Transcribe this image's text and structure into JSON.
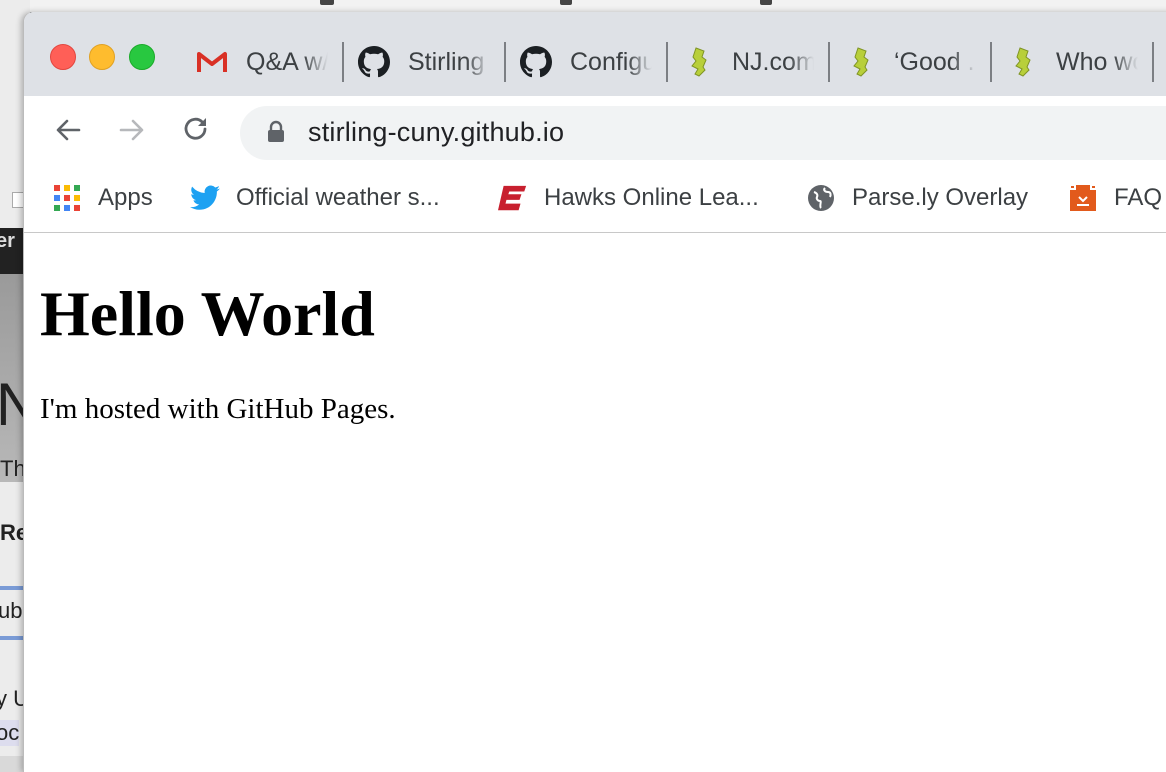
{
  "background_window": {
    "fragments": [
      "er",
      "N",
      "Th",
      "Re",
      "ub",
      "y U",
      "oc"
    ]
  },
  "tabs": [
    {
      "title": "Q&A w/",
      "icon": "gmail-icon"
    },
    {
      "title": "Stirling",
      "icon": "github-icon"
    },
    {
      "title": "Configu",
      "icon": "github-icon"
    },
    {
      "title": "NJ.com",
      "icon": "nj-icon"
    },
    {
      "title": "‘Good ...",
      "icon": "nj-icon"
    },
    {
      "title": "Who wo",
      "icon": "nj-icon"
    }
  ],
  "toolbar": {
    "back_icon": "back-arrow-icon",
    "forward_icon": "forward-arrow-icon",
    "reload_icon": "reload-icon",
    "url": "stirling-cuny.github.io"
  },
  "bookmarks": [
    {
      "label": "Apps",
      "icon": "apps-grid-icon"
    },
    {
      "label": "Official weather s...",
      "icon": "twitter-icon"
    },
    {
      "label": "Hawks Online Lea...",
      "icon": "brand-e-icon"
    },
    {
      "label": "Parse.ly Overlay",
      "icon": "globe-icon"
    },
    {
      "label": "FAQ",
      "icon": "faq-icon"
    }
  ],
  "page": {
    "heading": "Hello World",
    "body": "I'm hosted with GitHub Pages."
  },
  "colors": {
    "tabstrip": "#dee1e6",
    "omnibox": "#f1f3f4",
    "close": "#ff5f57",
    "minimize": "#febc2e",
    "maximize": "#28c840"
  }
}
